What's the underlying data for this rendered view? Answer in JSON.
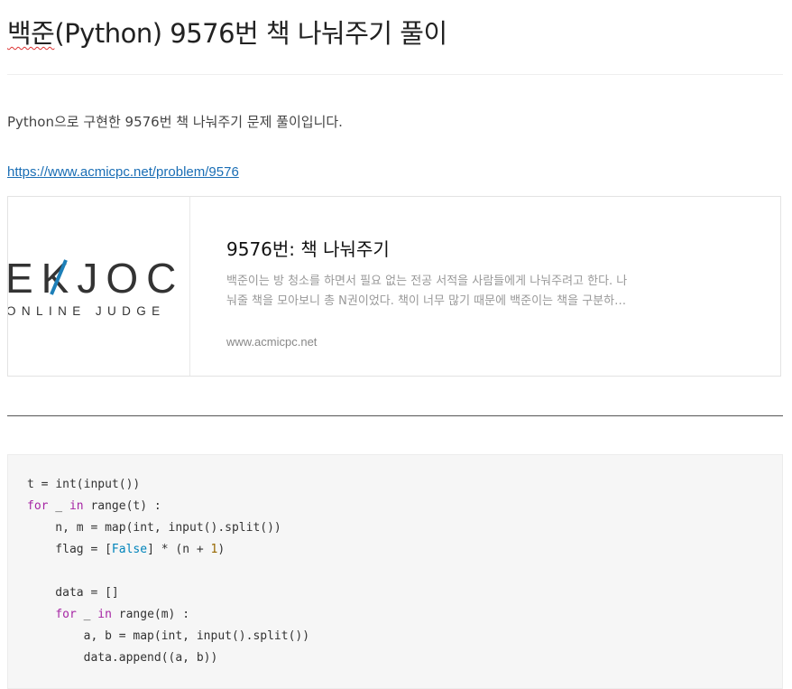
{
  "post": {
    "title_spell": "백준",
    "title_rest": "(Python) 9576번 책 나눠주기 풀이",
    "intro": "Python으로 구현한 9576번 책 나눠주기 문제 풀이입니다.",
    "link_text": "https://www.acmicpc.net/problem/9576"
  },
  "card": {
    "logo_main": "EKJOC",
    "logo_sub": "ONLINE JUDGE",
    "title": "9576번: 책 나눠주기",
    "desc_line1": "백준이는 방 청소를 하면서 필요 없는 전공 서적을 사람들에게 나눠주려고 한다. 나",
    "desc_line2": "눠줄 책을 모아보니 총 N권이었다. 책이 너무 많기 때문에 백준이는 책을 구분하…",
    "url": "www.acmicpc.net"
  },
  "code": {
    "t": "t",
    "eq": " = ",
    "int_input": "int(input())",
    "for": "for",
    "underscore": " _ ",
    "in": "in",
    "range_t": " range(t) :",
    "nm_line": "    n, m = map(int, input().split())",
    "flag_pre": "    flag = [",
    "false_kw": "False",
    "flag_mid": "] * (n + ",
    "one": "1",
    "flag_end": ")",
    "data_line": "    data = []",
    "indent4": "    ",
    "range_m": " range(m) :",
    "ab_line": "        a, b = map(int, input().split())",
    "append_line": "        data.append((a, b))"
  }
}
